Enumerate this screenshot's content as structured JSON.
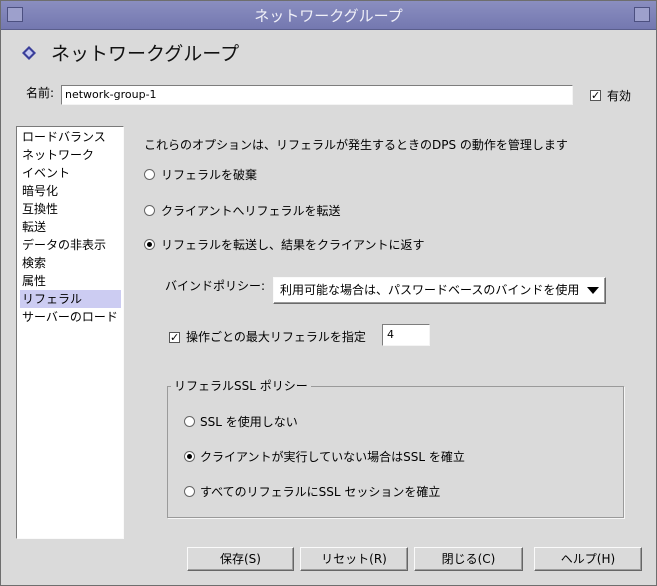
{
  "window": {
    "title": "ネットワークグループ"
  },
  "header": {
    "title": "ネットワークグループ",
    "icon": "diamond-bullet-icon"
  },
  "name_field": {
    "label": "名前:",
    "value": "network-group-1"
  },
  "enabled": {
    "label": "有効",
    "checked": true
  },
  "sidebar": {
    "items": [
      {
        "label": "ロードバランス"
      },
      {
        "label": "ネットワーク"
      },
      {
        "label": "イベント"
      },
      {
        "label": "暗号化"
      },
      {
        "label": "互換性"
      },
      {
        "label": "転送"
      },
      {
        "label": "データの非表示"
      },
      {
        "label": "検索"
      },
      {
        "label": "属性"
      },
      {
        "label": "リフェラル",
        "selected": true
      },
      {
        "label": "サーバーのロード"
      }
    ]
  },
  "main": {
    "description": "これらのオプションは、リフェラルが発生するときのDPS の動作を管理します",
    "referral_options": [
      {
        "label": "リフェラルを破棄",
        "selected": false
      },
      {
        "label": "クライアントへリフェラルを転送",
        "selected": false
      },
      {
        "label": "リフェラルを転送し、結果をクライアントに返す",
        "selected": true
      }
    ],
    "bind_policy": {
      "label": "バインドポリシー:",
      "value": "利用可能な場合は、パスワードベースのバインドを使用"
    },
    "max_referrals": {
      "label": "操作ごとの最大リフェラルを指定",
      "checked": true,
      "value": "4"
    },
    "ssl_policy": {
      "legend": "リフェラルSSL ポリシー",
      "options": [
        {
          "label": "SSL を使用しない",
          "selected": false
        },
        {
          "label": "クライアントが実行していない場合はSSL を確立",
          "selected": true
        },
        {
          "label": "すべてのリフェラルにSSL セッションを確立",
          "selected": false
        }
      ]
    }
  },
  "footer": {
    "save": "保存(S)",
    "reset": "リセット(R)",
    "close": "閉じる(C)",
    "help": "ヘルプ(H)"
  },
  "colors": {
    "titlebar": "#7a7eb6",
    "selection": "#ccccf2",
    "background": "#dadada"
  }
}
